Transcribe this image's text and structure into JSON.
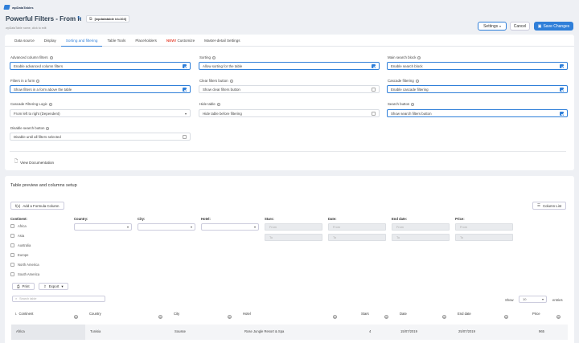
{
  "app": {
    "logo_text": "wpDataTables"
  },
  "header": {
    "title": "Powerful Filters - From left to",
    "shortcode": "[wpdatatable id=104]",
    "subtitle": "wpDataTable name, click to edit",
    "settings_label": "Settings",
    "cancel_label": "Cancel",
    "save_label": "Save Changes"
  },
  "tabs": [
    {
      "label": "Data source"
    },
    {
      "label": "Display"
    },
    {
      "label": "Sorting and filtering"
    },
    {
      "label": "Table Tools"
    },
    {
      "label": "Placeholders"
    },
    {
      "badge": "NEW!",
      "label": "Customize"
    },
    {
      "label": "Master-detail Settings"
    }
  ],
  "fields": {
    "adv_filters": {
      "label": "Advanced column filters",
      "value": "Enable advanced column filters"
    },
    "filters_form": {
      "label": "Filters in a form",
      "value": "Show filters in a form above the table"
    },
    "cascade_logic": {
      "label": "Cascade Filtering Logic",
      "value": "From left to right (Dependent)"
    },
    "disable_search": {
      "label": "Disable search button",
      "value": "Disable until all filters selected"
    },
    "sorting": {
      "label": "Sorting",
      "value": "Allow sorting for the table"
    },
    "clear_filters": {
      "label": "Clear filters button",
      "value": "Show clear filters button"
    },
    "hide_table": {
      "label": "Hide table",
      "value": "Hide table before filtering"
    },
    "main_search": {
      "label": "Main search block",
      "value": "Enable search block"
    },
    "cascade_filtering": {
      "label": "Cascade filtering",
      "value": "Enable cascade filtering"
    },
    "search_button": {
      "label": "Search button",
      "value": "Show search filters button"
    }
  },
  "view_docs": "View Documentation",
  "preview": {
    "title": "Table preview and columns setup",
    "add_formula": "Add a Formula Column",
    "column_list": "Column List",
    "filters": {
      "continent": "Continent:",
      "continents": [
        "Africa",
        "Asia",
        "Australia",
        "Europe",
        "North America",
        "South America"
      ],
      "country": "Country:",
      "city": "City:",
      "hotel": "Hotel:",
      "stars": "Stars:",
      "date": "Date:",
      "end_date": "End date:",
      "price": "Price:",
      "from": "From",
      "to": "To"
    },
    "print": "Print",
    "export": "Export",
    "search_placeholder": "Search table",
    "show": "Show",
    "entries_value": "10",
    "entries": "entries",
    "columns": [
      "Continent",
      "Country",
      "City",
      "Hotel",
      "Stars",
      "Date",
      "End date",
      "Price"
    ],
    "rows": [
      [
        "Africa",
        "Tunisia",
        "Sousse",
        "Rose Jungle Resort & Spa",
        "4",
        "15/07/2019",
        "25/07/2019",
        "965"
      ]
    ]
  }
}
